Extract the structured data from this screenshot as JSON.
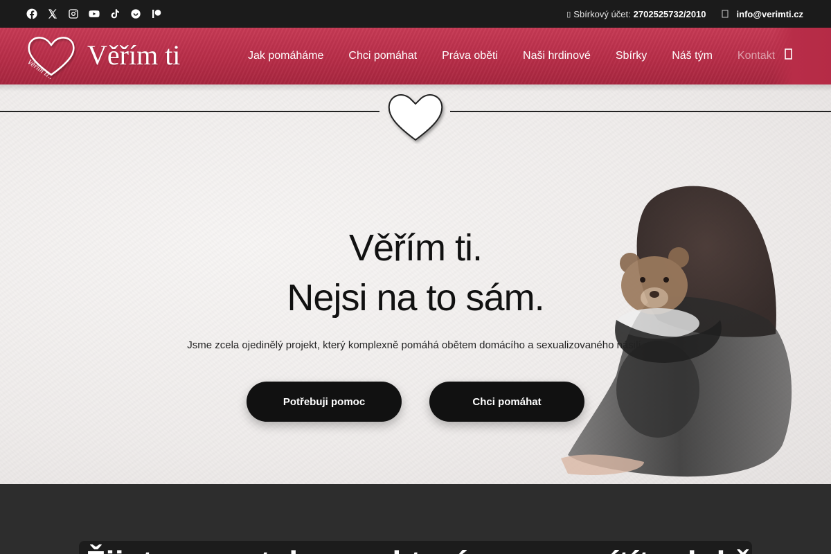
{
  "topbar": {
    "socials": [
      "facebook-icon",
      "x-icon",
      "instagram-icon",
      "youtube-icon",
      "tiktok-icon",
      "darujme-icon",
      "patreon-icon"
    ],
    "account_label": "Sbírkový účet:",
    "account_number": "2702525732/2010",
    "email": "info@verimti.cz"
  },
  "header": {
    "brand": "Věřím ti",
    "logo_script": "Věřím ti...",
    "nav": [
      "Jak pomáháme",
      "Chci pomáhat",
      "Práva oběti",
      "Naši hrdinové",
      "Sbírky",
      "Náš tým",
      "Kontakt"
    ],
    "colors": {
      "accent": "#b82d48",
      "dark": "#1b1b1b"
    }
  },
  "hero": {
    "title_line1": "Věřím ti.",
    "title_line2": "Nejsi na to sám.",
    "subtitle": "Jsme zcela ojedinělý projekt, který komplexně pomáhá obětem domácího a sexualizovaného násilí.",
    "cta_primary": "Potřebuji pomoc",
    "cta_secondary": "Chci pomáhat"
  },
  "section": {
    "heading": "Žijete ve vztahu, ve kterém se necítíte dobře?"
  }
}
